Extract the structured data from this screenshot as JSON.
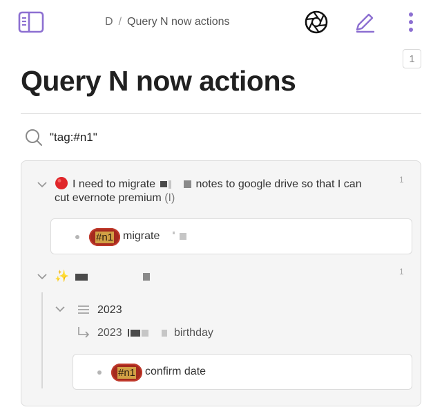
{
  "header": {
    "breadcrumb": [
      "D",
      "Query N now actions"
    ],
    "sidebar_icon": "sidebar-icon",
    "camera_icon": "aperture-icon",
    "edit_icon": "pencil-icon",
    "more_icon": "vertical-ellipsis-icon"
  },
  "page": {
    "title": "Query N now actions",
    "count": "1",
    "query": "\"tag:#n1\""
  },
  "results": {
    "block1": {
      "line1_a": "I need to migrate",
      "line1_b": "notes to google drive so that I can",
      "line2": "cut evernote premium",
      "line2_suffix": "(I)",
      "count": "1",
      "child_tag": "#n1",
      "child_text": "migrate"
    },
    "block2": {
      "count": "1",
      "heading": "2023",
      "ref_prefix": "2023",
      "ref_suffix": "birthday",
      "child_tag": "#n1",
      "child_text": "confirm date"
    }
  },
  "colors": {
    "accent": "#8c6fd1",
    "tag_bg": "#a52a1e",
    "tag_highlight": "#d2a045"
  }
}
